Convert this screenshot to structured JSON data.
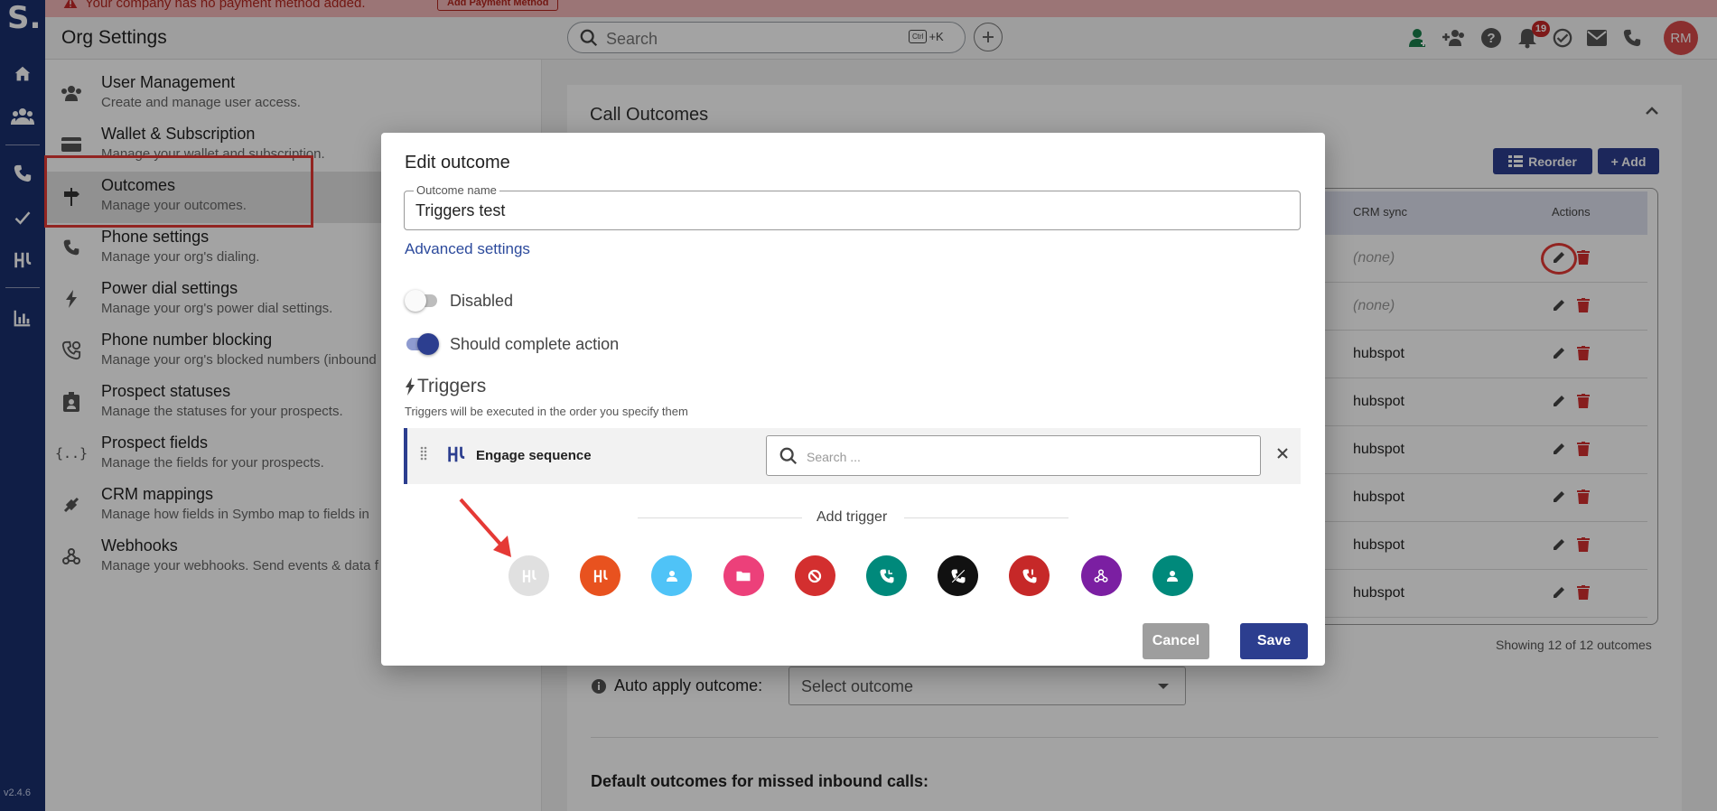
{
  "app": {
    "logo": "S.",
    "version": "v2.4.6"
  },
  "banner": {
    "text": "Your company has no payment method added.",
    "button": "Add Payment Method"
  },
  "header": {
    "title": "Org Settings",
    "search_placeholder": "Search",
    "shortcut_ctrl": "Ctrl",
    "shortcut_key": "+K",
    "notification_count": "19",
    "avatar_initials": "RM"
  },
  "nav": {
    "items": [
      {
        "title": "User Management",
        "desc": "Create and manage user access."
      },
      {
        "title": "Wallet & Subscription",
        "desc": "Manage your wallet and subscription."
      },
      {
        "title": "Outcomes",
        "desc": "Manage your outcomes."
      },
      {
        "title": "Phone settings",
        "desc": "Manage your org's dialing."
      },
      {
        "title": "Power dial settings",
        "desc": "Manage your org's power dial settings."
      },
      {
        "title": "Phone number blocking",
        "desc": "Manage your org's blocked numbers (inbound"
      },
      {
        "title": "Prospect statuses",
        "desc": "Manage the statuses for your prospects."
      },
      {
        "title": "Prospect fields",
        "desc": "Manage the fields for your prospects."
      },
      {
        "title": "CRM mappings",
        "desc": "Manage how fields in Symbo map to fields in"
      },
      {
        "title": "Webhooks",
        "desc": "Manage your webhooks. Send events & data f"
      }
    ]
  },
  "outcomes_card": {
    "title": "Call Outcomes",
    "reorder_label": "Reorder",
    "add_label": "+ Add",
    "col_crm": "CRM sync",
    "col_actions": "Actions",
    "rows": [
      "(none)",
      "(none)",
      "hubspot",
      "hubspot",
      "hubspot",
      "hubspot",
      "hubspot",
      "hubspot"
    ],
    "showing": "Showing 12 of 12 outcomes",
    "auto_apply_label": "Auto apply outcome:",
    "auto_apply_value": "Select outcome",
    "defaults_heading": "Default outcomes for missed inbound calls:"
  },
  "modal": {
    "title": "Edit outcome",
    "field_label": "Outcome name",
    "field_value": "Triggers test",
    "advanced": "Advanced settings",
    "toggle_disabled": "Disabled",
    "toggle_complete": "Should complete action",
    "triggers_heading": "Triggers",
    "triggers_sub": "Triggers will be executed in the order you specify them",
    "trigger_name": "Engage sequence",
    "trigger_search_placeholder": "Search ...",
    "add_trigger": "Add trigger",
    "trigger_icons": [
      {
        "name": "sequence-trigger",
        "color": "#e0e0e0"
      },
      {
        "name": "sequence-alt-trigger",
        "color": "#e8521f"
      },
      {
        "name": "assign-user-trigger",
        "color": "#4fc3f7"
      },
      {
        "name": "folder-trigger",
        "color": "#ec407a"
      },
      {
        "name": "block-trigger",
        "color": "#d32f2f"
      },
      {
        "name": "phone-callback-trigger",
        "color": "#00897b"
      },
      {
        "name": "no-call-trigger",
        "color": "#111111"
      },
      {
        "name": "phone-missed-trigger",
        "color": "#c62828"
      },
      {
        "name": "webhook-trigger",
        "color": "#7b1fa2"
      },
      {
        "name": "contact-status-trigger",
        "color": "#00897b"
      }
    ],
    "cancel": "Cancel",
    "save": "Save"
  },
  "colors": {
    "primary": "#2c3e8f",
    "rail": "#1a2f6e",
    "annotation": "#e53935"
  }
}
